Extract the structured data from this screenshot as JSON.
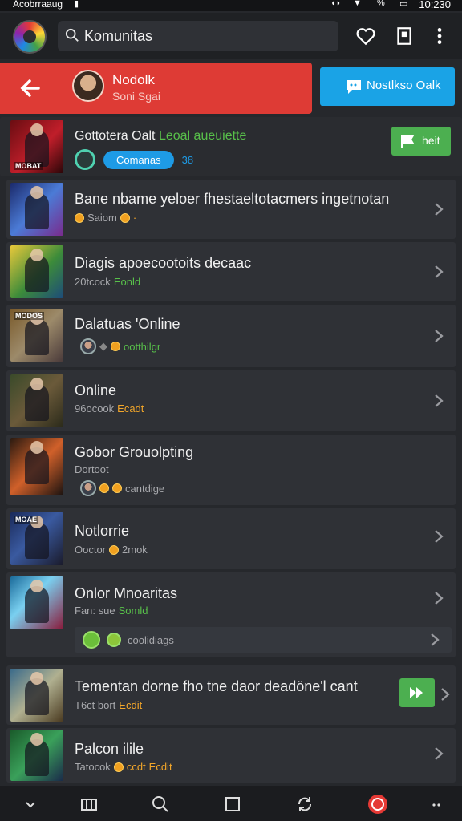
{
  "status_bar": {
    "carrier": "Acobrraaug",
    "battery": "%",
    "time": "10:230"
  },
  "search": {
    "value": "Komunitas"
  },
  "header": {
    "user_name": "Nodolk",
    "user_sub": "Soni Sgai",
    "action_button": "Nostlkso Oalk"
  },
  "featured": {
    "title": "Gottotera Oalt",
    "title_highlight": "Leoal aueuiette",
    "pill": "Comanas",
    "count": "38",
    "thumb_tag": "MOBAT",
    "button": "heit"
  },
  "items": [
    {
      "title": "Bane nbame yeloer fhestaeltotacmers ingetnotan",
      "meta": "Saiom",
      "tag": ""
    },
    {
      "title": "Diagis apoecootoits decaac",
      "meta": "20tcock",
      "meta_green": "Eonld",
      "tag": ""
    },
    {
      "title": "Dalatuas 'Online",
      "meta": "ootthilgr",
      "tag": "MODOS"
    },
    {
      "title": "Online",
      "meta": "96ocook",
      "meta_orange": "Ecadt",
      "tag": ""
    },
    {
      "title": "Gobor Grouolpting",
      "meta_line": "Dortoot",
      "meta": "cantdige",
      "tag": ""
    },
    {
      "title": "Notlorrie",
      "meta": "Ooctor",
      "meta_after_coin": "2mok",
      "tag": "MOAE"
    },
    {
      "title": "Onlor Mnoaritas",
      "meta": "Fan: sue",
      "meta_green": "Somld",
      "sub_row": "coolidiags",
      "tag": ""
    },
    {
      "title": "Tementan dorne fho tne daor deadöne'l cant",
      "meta": "T6ct bort",
      "meta_orange": "Ecdit",
      "tag": ""
    },
    {
      "title": "Palcon ilile",
      "meta": "Tatocok",
      "meta_orange": "ccdt",
      "meta_orange2": "Ecdit",
      "tag": ""
    }
  ],
  "nav": [
    "chevron-down",
    "panels",
    "search",
    "square",
    "sync",
    "record",
    "more"
  ],
  "colors": {
    "accent_red": "#de3b35",
    "accent_blue": "#1aa3e6",
    "accent_green": "#4caf50",
    "background": "#26282c"
  }
}
